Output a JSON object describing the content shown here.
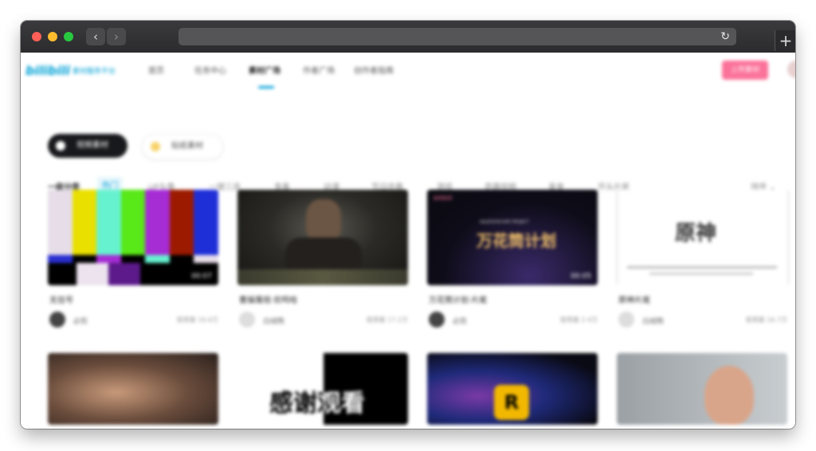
{
  "browser": {
    "back": "‹",
    "forward": "›",
    "reload": "↻",
    "new_tab": "+"
  },
  "header": {
    "logo": "bilibili",
    "logo_sub": "素材服务平台",
    "nav": [
      "首页",
      "任务中心",
      "素材广场",
      "作者广场",
      "创作者指南"
    ],
    "active_nav": "素材广场",
    "upload_button": "上传素材"
  },
  "toggles": {
    "video": "视频素材",
    "sticker": "贴纸素材"
  },
  "categories": {
    "label": "一级分类",
    "items": [
      "热门",
      "UP头像",
      "一键三连",
      "鬼畜",
      "动漫",
      "节日庆典",
      "游戏",
      "奇趣视频",
      "美食",
      "开头片尾"
    ],
    "active": "热门",
    "sort": "排序 ⌄"
  },
  "cards": [
    {
      "title": "无信号",
      "author": "必剪",
      "usage": "使用量 16.6万",
      "duration": "00:07"
    },
    {
      "title": "曹操蔑视·欢鸣哈",
      "author": "白绒熊",
      "usage": "使用量 17.2万",
      "duration": ""
    },
    {
      "title": "万花筒计划·片尾",
      "author": "必剪",
      "usage": "使用量 2.4万",
      "duration": "00:05"
    },
    {
      "title": "原神片尾",
      "author": "白绒熊",
      "usage": "使用量 16.7万",
      "duration": ""
    }
  ],
  "thumb_texts": {
    "kaleidoscope_title": "万花筒计划",
    "kaleidoscope_small": "KALEIDOSCOPE PROJECT",
    "genshin_logo": "原神",
    "thanks": "感谢观看",
    "rockstar": "R"
  },
  "colors": {
    "accent": "#00a1d6",
    "upload": "#fb7299",
    "dark_button": "#18191c"
  }
}
